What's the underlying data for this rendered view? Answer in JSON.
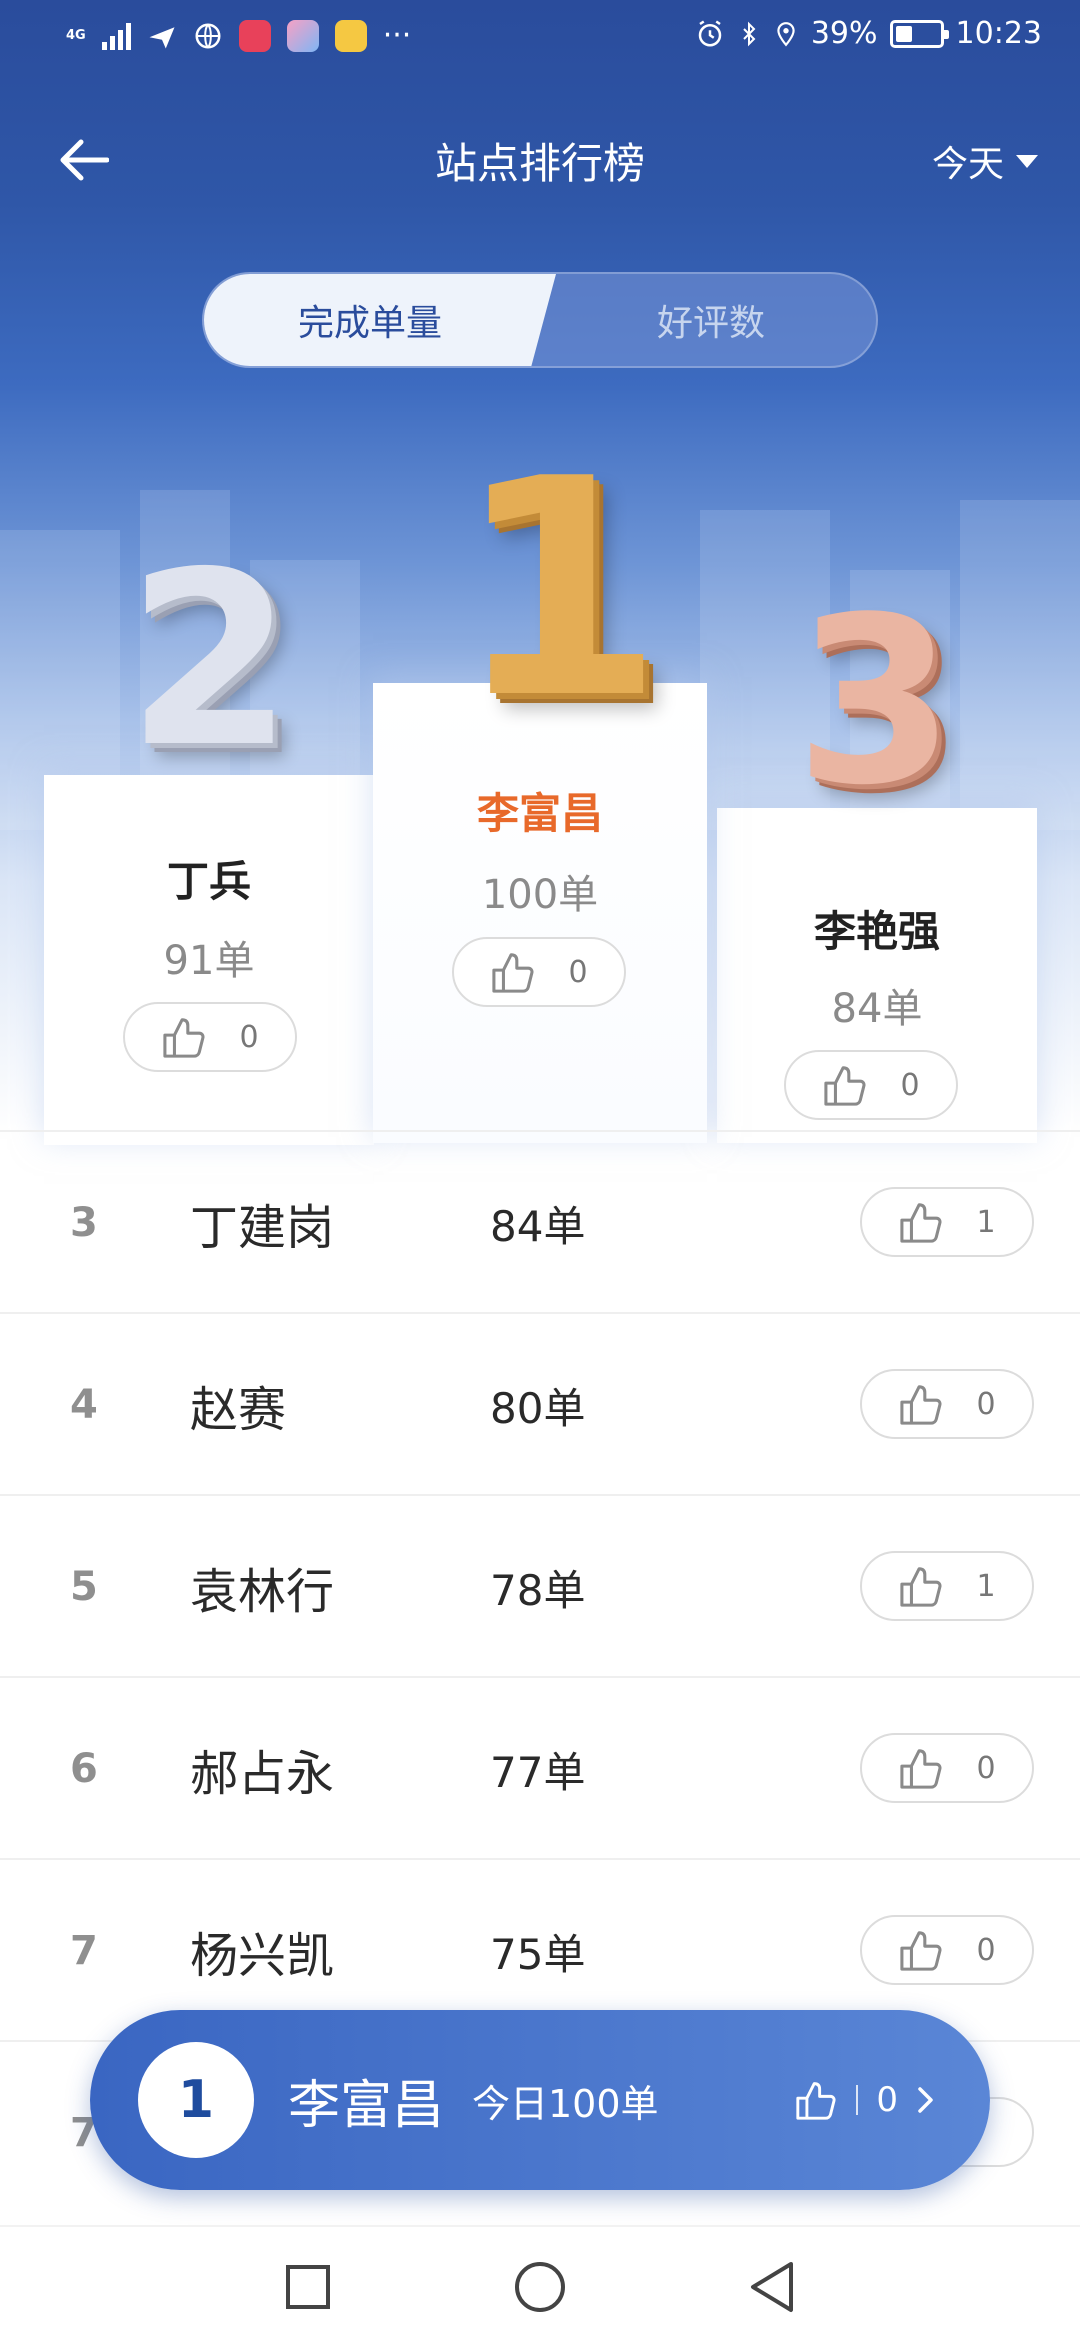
{
  "status_bar": {
    "network": "4G",
    "battery": "39%",
    "battery_level": 0.39,
    "time": "10:23",
    "more": "···"
  },
  "header": {
    "title": "站点排行榜",
    "date_filter": "今天"
  },
  "tabs": {
    "active": "完成单量",
    "inactive": "好评数"
  },
  "podium": {
    "first": {
      "rank": "1",
      "name": "李富昌",
      "orders": "100单",
      "likes": "0"
    },
    "second": {
      "rank": "2",
      "name": "丁兵",
      "orders": "91单",
      "likes": "0"
    },
    "third": {
      "rank": "3",
      "name": "李艳强",
      "orders": "84单",
      "likes": "0"
    }
  },
  "rankings": [
    {
      "rank": "3",
      "name": "丁建岗",
      "orders": "84单",
      "likes": "1"
    },
    {
      "rank": "4",
      "name": "赵赛",
      "orders": "80单",
      "likes": "0"
    },
    {
      "rank": "5",
      "name": "袁林行",
      "orders": "78单",
      "likes": "1"
    },
    {
      "rank": "6",
      "name": "郝占永",
      "orders": "77单",
      "likes": "0"
    },
    {
      "rank": "7",
      "name": "杨兴凯",
      "orders": "75单",
      "likes": "0"
    },
    {
      "rank": "7",
      "name": "",
      "orders": "",
      "likes": ""
    }
  ],
  "my_rank": {
    "rank": "1",
    "name": "李富昌",
    "summary": "今日100单",
    "likes": "0"
  },
  "colors": {
    "header_blue": "#2a4c9c",
    "first_place_name": "#e8692a",
    "gold": "#e4ad55",
    "silver": "#dfe3ee",
    "bronze": "#eab5a2"
  }
}
